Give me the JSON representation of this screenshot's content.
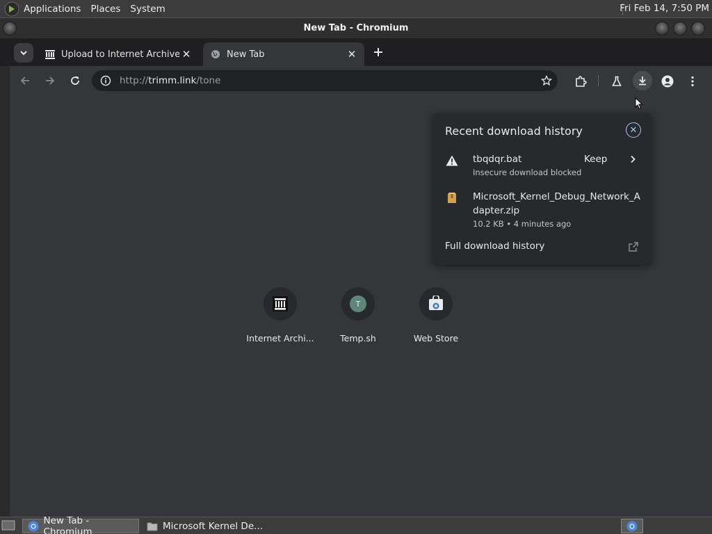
{
  "top_panel": {
    "menus": [
      "Applications",
      "Places",
      "System"
    ],
    "clock": "Fri Feb 14,  7:50 PM"
  },
  "window": {
    "title": "New Tab - Chromium"
  },
  "tabs": [
    {
      "label": "Upload to Internet Archive",
      "active": false
    },
    {
      "label": "New Tab",
      "active": true
    }
  ],
  "omnibox": {
    "url_prefix": "http://",
    "url_host": "trimm.link",
    "url_path": "/tone"
  },
  "shortcuts": [
    {
      "label": "Internet Archi...",
      "icon": "archive-icon"
    },
    {
      "label": "Temp.sh",
      "icon": "letter-avatar-icon",
      "letter": "T"
    },
    {
      "label": "Web Store",
      "icon": "web-store-icon"
    }
  ],
  "downloads": {
    "title": "Recent download history",
    "items": [
      {
        "name": "tbqdqr.bat",
        "status": "Insecure download blocked",
        "action": "Keep",
        "icon": "warning-icon"
      },
      {
        "name": "Microsoft_Kernel_Debug_Network_Adapter.zip",
        "status": "10.2 KB • 4 minutes ago",
        "icon": "zip-file-icon"
      }
    ],
    "full_history": "Full download history"
  },
  "taskbar": {
    "tasks": [
      {
        "label": "New Tab - Chromium",
        "active": true
      },
      {
        "label": "Microsoft Kernel De...",
        "active": false
      }
    ]
  },
  "colors": {
    "page_bg": "#35363a",
    "accent_link": "#a8c7fa",
    "panel_bg": "#3c3c3c"
  }
}
